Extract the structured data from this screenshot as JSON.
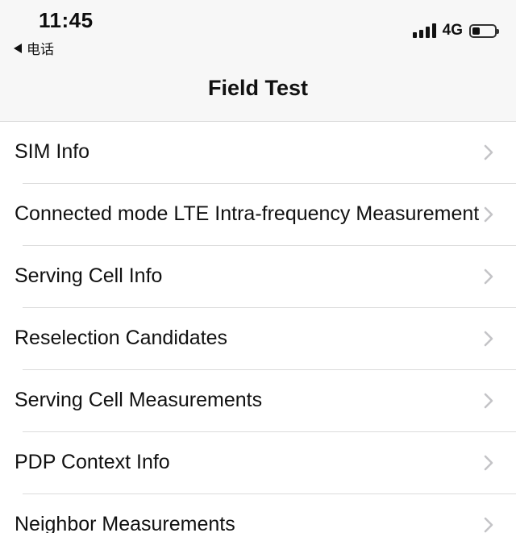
{
  "status_bar": {
    "time": "11:45",
    "back_label": "电话",
    "network": "4G",
    "battery_level_percent": 35,
    "signal_bars": 4
  },
  "nav": {
    "title": "Field Test"
  },
  "list": {
    "items": [
      {
        "label": "SIM Info"
      },
      {
        "label": "Connected mode LTE Intra-frequency Measurement"
      },
      {
        "label": "Serving Cell Info"
      },
      {
        "label": "Reselection Candidates"
      },
      {
        "label": "Serving Cell Measurements"
      },
      {
        "label": "PDP Context Info"
      },
      {
        "label": "Neighbor Measurements"
      }
    ]
  },
  "icons": {
    "back": "back-arrow-icon",
    "signal": "signal-strength-icon",
    "battery": "battery-icon",
    "disclosure": "chevron-right-icon"
  },
  "colors": {
    "header_background": "#f7f7f7",
    "list_background": "#ffffff",
    "separator": "#dcdcdc",
    "chevron": "#c4c4c7",
    "text": "#111111"
  }
}
